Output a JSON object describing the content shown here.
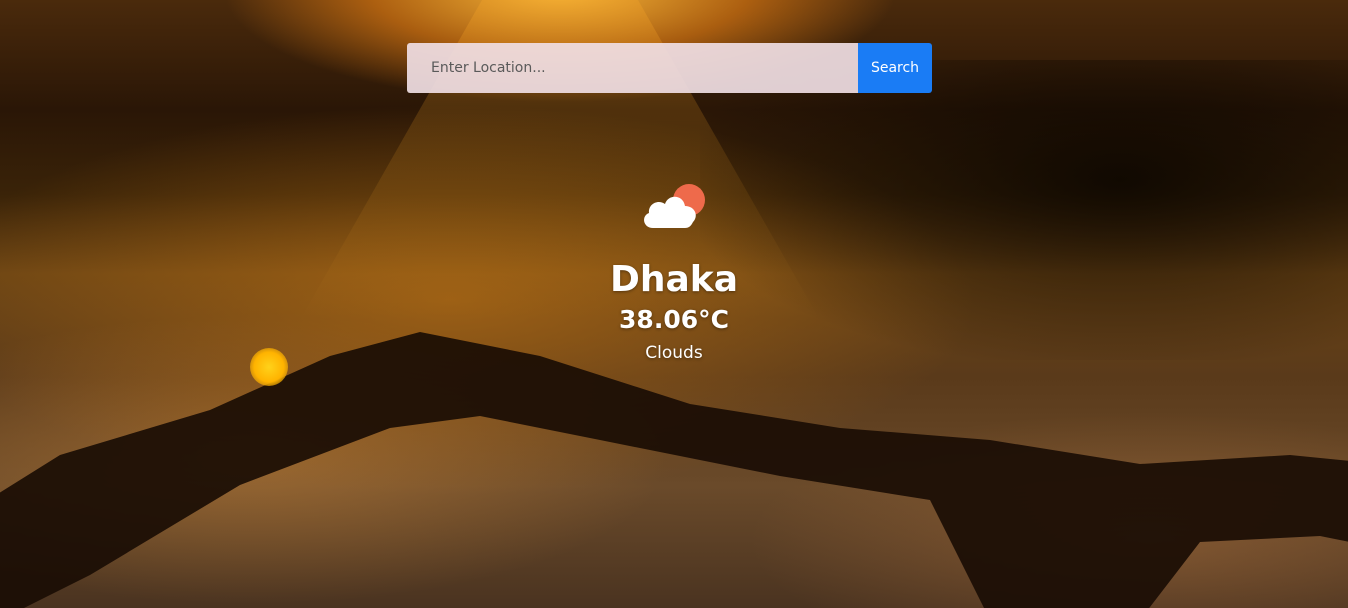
{
  "search": {
    "placeholder": "Enter Location...",
    "value": "",
    "button_label": "Search"
  },
  "weather": {
    "icon": "sun-behind-cloud-icon",
    "city": "Dhaka",
    "temperature": "38.06°C",
    "condition": "Clouds"
  },
  "colors": {
    "button": "#1a7cf5",
    "cloud": "#ffffff",
    "sun": "#ee6a4b"
  }
}
